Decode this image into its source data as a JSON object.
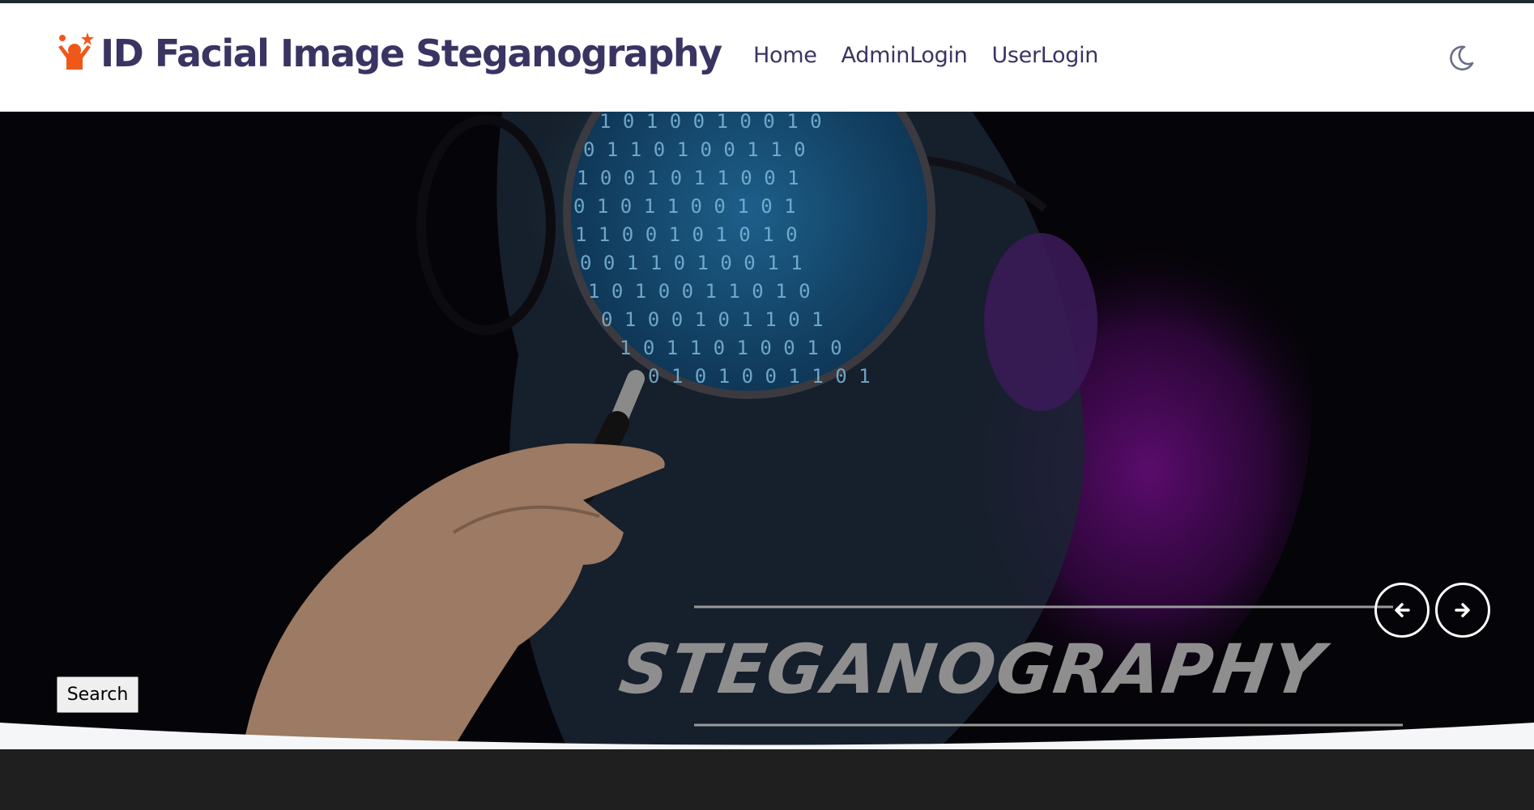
{
  "brand": {
    "title": "ID Facial Image Steganography",
    "accent": "#f0581a",
    "color": "#3a3463"
  },
  "nav": {
    "items": [
      {
        "label": "Home"
      },
      {
        "label": "AdminLogin"
      },
      {
        "label": "UserLogin"
      }
    ]
  },
  "theme_toggle": {
    "icon": "moon-icon"
  },
  "hero": {
    "wordmark": "STEGANOGRAPHY",
    "binary_text": [
      "1 0 1 0 0 1 0 0 1 0",
      "0 1 1 0 1 0 0 1 1 0",
      "1 0 0 1 0 1 1 0 0 1",
      "0 1 0 1 1 0 0 1 0 1",
      "1 1 0 0 1 0 1 0 1 0",
      "0 0 1 1 0 1 0 0 1 1",
      "1 0 1 0 0 1 1 0 1 0",
      "0 1 0 0 1 0 1 1 0 1",
      "1 0 1 1 0 1 0 0 1 0",
      "0 1 0 1 0 0 1 1 0 1"
    ],
    "prev_icon": "arrow-left-icon",
    "next_icon": "arrow-right-icon"
  },
  "search": {
    "label": "Search"
  }
}
